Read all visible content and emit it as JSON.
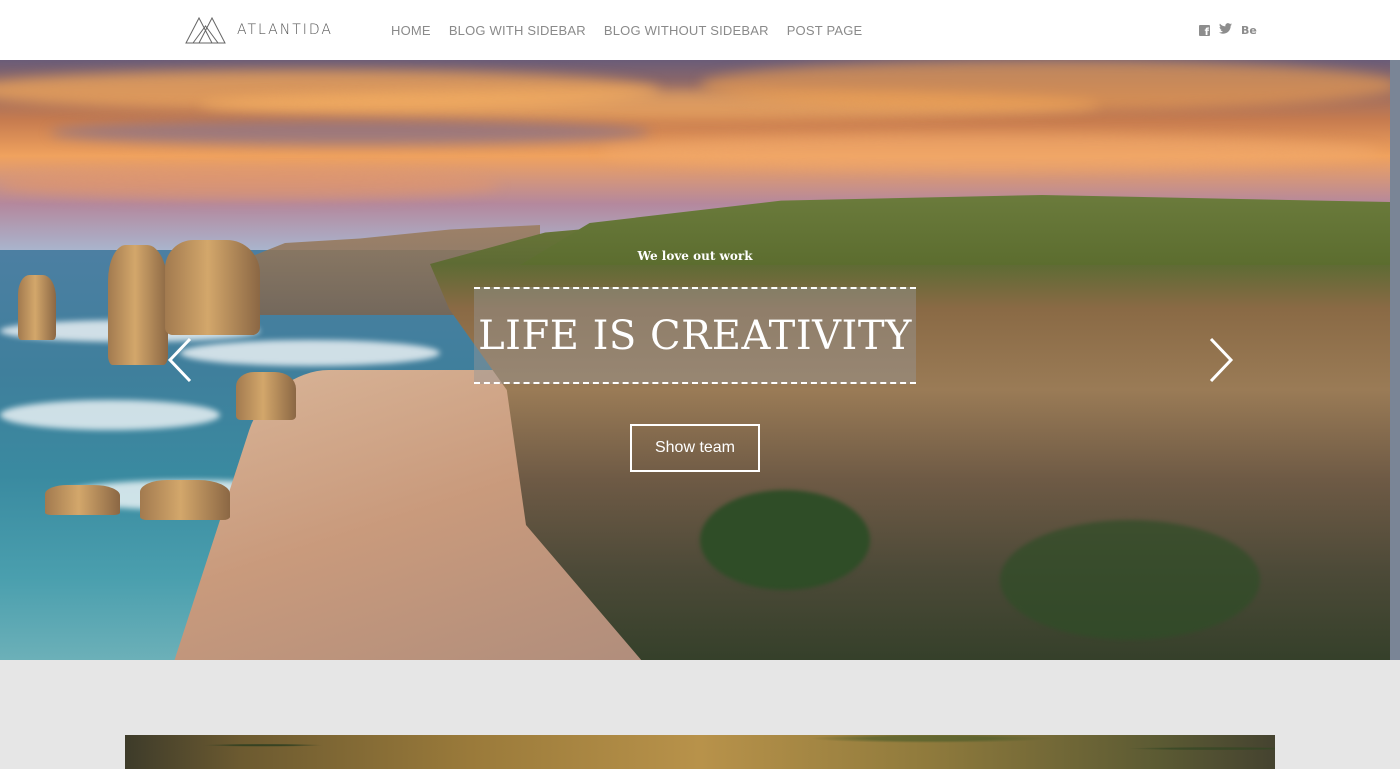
{
  "brand": {
    "name": "ATLANTIDA"
  },
  "nav": {
    "items": [
      {
        "label": "HOME"
      },
      {
        "label": "BLOG WITH SIDEBAR"
      },
      {
        "label": "BLOG WITHOUT SIDEBAR"
      },
      {
        "label": "POST PAGE"
      }
    ]
  },
  "social": {
    "icons": [
      "facebook-icon",
      "twitter-icon",
      "behance-icon"
    ],
    "behance_label": "Be"
  },
  "hero": {
    "subtitle": "We love out work",
    "title": "LIFE IS CREATIVITY",
    "button_label": "Show team"
  },
  "colors": {
    "header_bg": "#ffffff",
    "nav_text": "#8a8a8a",
    "page_bg": "#e6e6e6",
    "hero_text": "#ffffff"
  }
}
